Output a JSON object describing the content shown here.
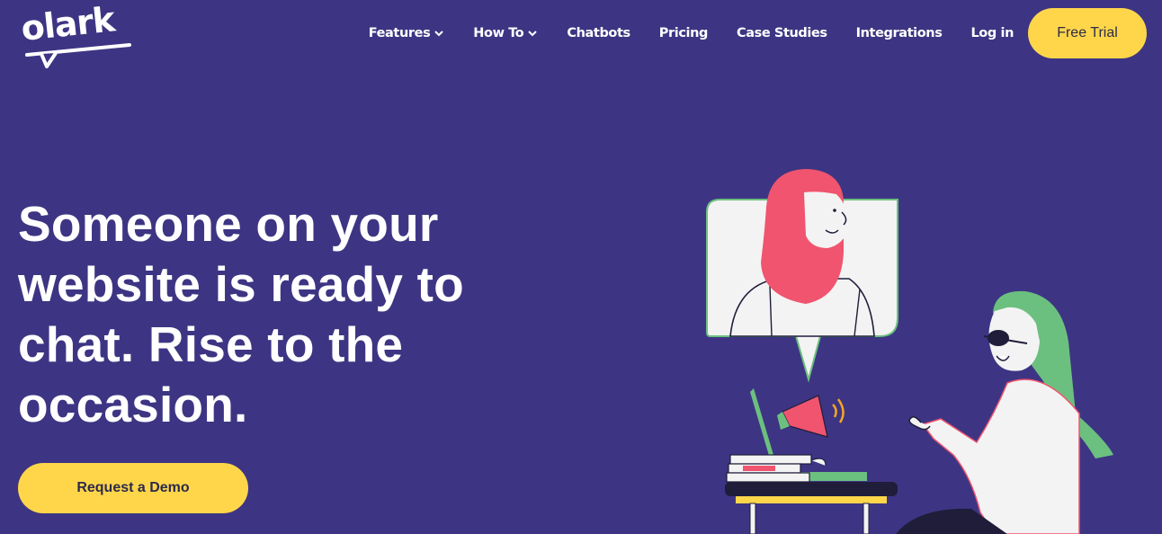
{
  "brand": {
    "logo_text": "olark"
  },
  "nav": {
    "items": [
      {
        "label": "Features",
        "has_dropdown": true
      },
      {
        "label": "How To",
        "has_dropdown": true
      },
      {
        "label": "Chatbots",
        "has_dropdown": false
      },
      {
        "label": "Pricing",
        "has_dropdown": false
      },
      {
        "label": "Case Studies",
        "has_dropdown": false
      },
      {
        "label": "Integrations",
        "has_dropdown": false
      },
      {
        "label": "Log in",
        "has_dropdown": false
      }
    ],
    "cta_label": "Free Trial"
  },
  "hero": {
    "headline_lines": [
      "Someone on your",
      "website is ready to",
      "chat. Rise to the",
      "occasion."
    ],
    "cta_label": "Request a Demo"
  },
  "colors": {
    "background": "#3d3583",
    "accent_yellow": "#ffd64a",
    "text_white": "#ffffff",
    "button_text": "#2d2a4a",
    "hijab_pink": "#f0546f",
    "hair_green": "#6cc07f"
  },
  "icons": {
    "dropdown": "chevron-down-icon",
    "megaphone": "megaphone-icon"
  }
}
